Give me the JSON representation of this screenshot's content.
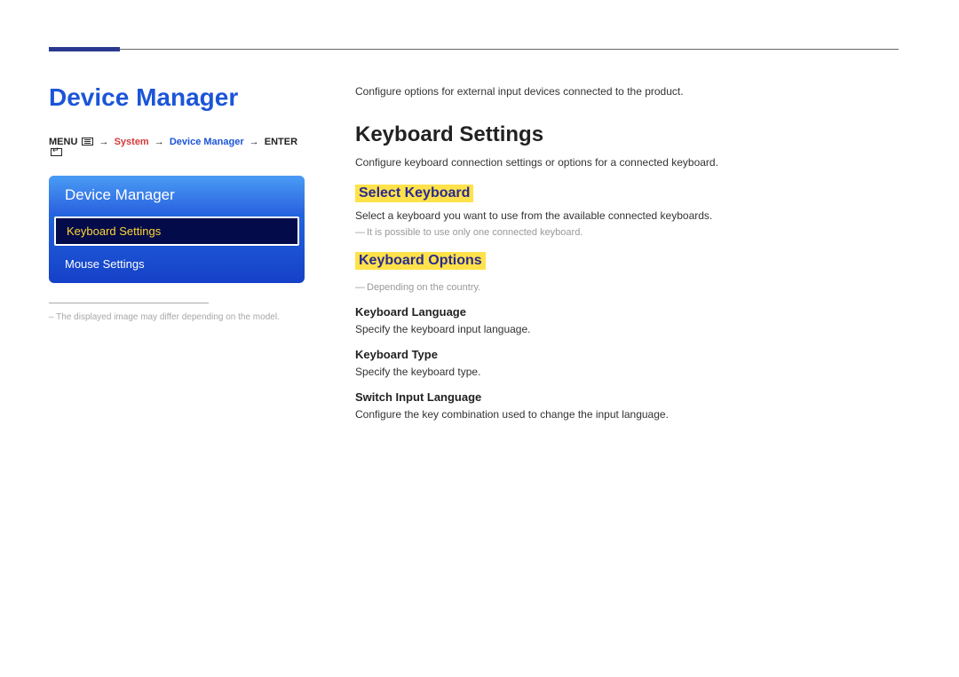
{
  "left": {
    "title": "Device Manager",
    "breadcrumb": {
      "menu": "MENU",
      "system": "System",
      "device": "Device Manager",
      "enter": "ENTER"
    },
    "panel": {
      "header": "Device Manager",
      "items": [
        {
          "label": "Keyboard Settings",
          "selected": true
        },
        {
          "label": "Mouse Settings",
          "selected": false
        }
      ]
    },
    "note": "The displayed image may differ depending on the model."
  },
  "right": {
    "intro": "Configure options for external input devices connected to the product.",
    "section_title": "Keyboard Settings",
    "section_body": "Configure keyboard connection settings or options for a connected keyboard.",
    "select_keyboard": {
      "heading": "Select Keyboard",
      "body": "Select a keyboard you want to use from the available connected keyboards.",
      "note": "It is possible to use only one connected keyboard."
    },
    "keyboard_options": {
      "heading": "Keyboard Options",
      "note": "Depending on the country.",
      "items": [
        {
          "title": "Keyboard Language",
          "body": "Specify the keyboard input language."
        },
        {
          "title": "Keyboard Type",
          "body": "Specify the keyboard type."
        },
        {
          "title": "Switch Input Language",
          "body": "Configure the key combination used to change the input language."
        }
      ]
    }
  }
}
